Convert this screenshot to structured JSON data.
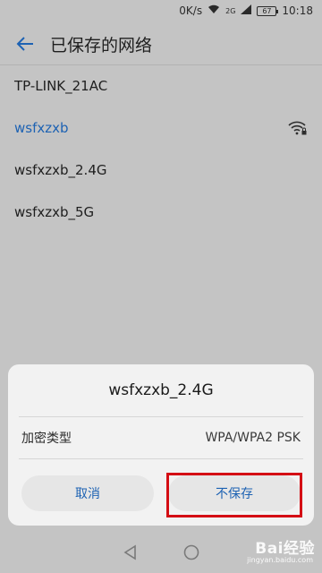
{
  "status_bar": {
    "speed": "0K/s",
    "battery": "67",
    "time": "10:18",
    "signal_label": "2G"
  },
  "app_bar": {
    "title": "已保存的网络"
  },
  "networks": [
    {
      "name": "TP-LINK_21AC"
    },
    {
      "name": "wsfxzxb"
    },
    {
      "name": "wsfxzxb_2.4G"
    },
    {
      "name": "wsfxzxb_5G"
    }
  ],
  "dialog": {
    "title": "wsfxzxb_2.4G",
    "encryption_label": "加密类型",
    "encryption_value": "WPA/WPA2 PSK",
    "cancel_label": "取消",
    "forget_label": "不保存"
  },
  "watermark": {
    "text": "Bai经验",
    "sub": "jingyan.baidu.com"
  },
  "colors": {
    "accent": "#1d62b3",
    "highlight": "#d40d14"
  }
}
